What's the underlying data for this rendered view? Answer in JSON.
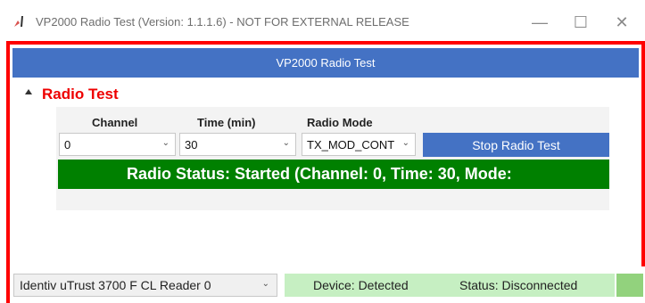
{
  "window": {
    "title": "VP2000 Radio Test (Version: 1.1.1.6) - NOT FOR EXTERNAL RELEASE",
    "minimize_label": "—",
    "maximize_label": "☐",
    "close_label": "✕"
  },
  "header": {
    "title": "VP2000 Radio Test"
  },
  "section": {
    "title": "Radio Test"
  },
  "form": {
    "channel": {
      "label": "Channel",
      "value": "0"
    },
    "time": {
      "label": "Time (min)",
      "value": "30"
    },
    "mode": {
      "label": "Radio Mode",
      "value": "TX_MOD_CONT"
    },
    "stop_button": "Stop Radio Test"
  },
  "radio_status": "Radio Status: Started (Channel: 0, Time: 30, Mode:",
  "status_bar": {
    "reader": "Identiv uTrust 3700 F CL Reader 0",
    "device": "Device: Detected",
    "connection": "Status: Disconnected"
  },
  "colors": {
    "frame": "#ff0000",
    "accent_blue": "#4472c4",
    "section_title": "#ee0000",
    "status_green": "#008000",
    "status_box": "#c6efc2"
  }
}
